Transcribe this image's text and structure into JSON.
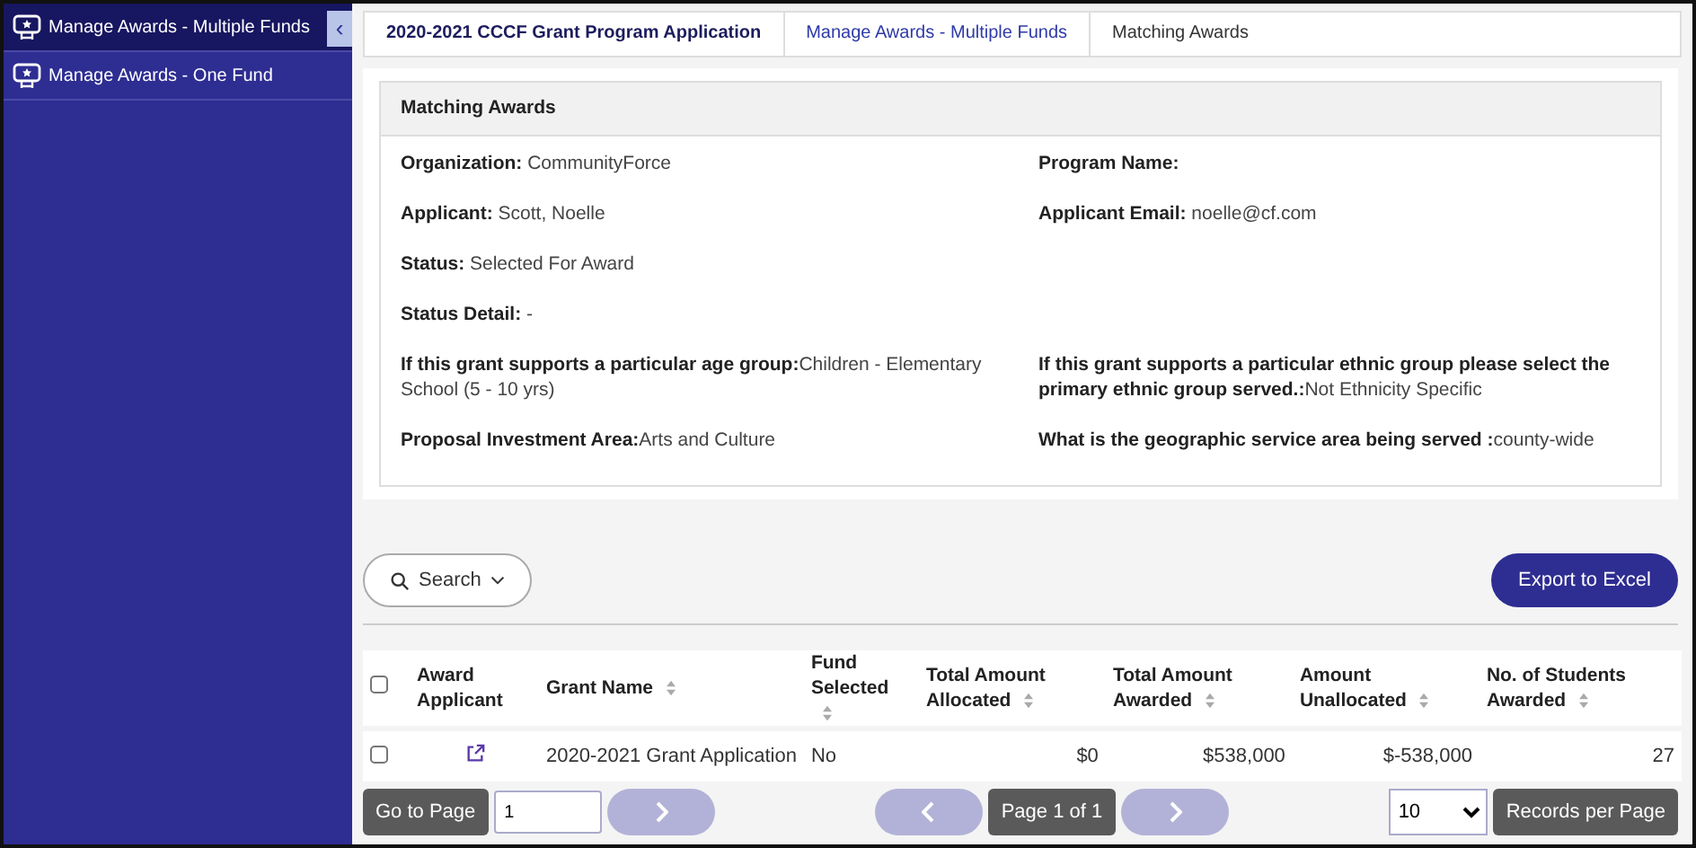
{
  "sidebar": {
    "items": [
      {
        "label": "Manage Awards - Multiple Funds",
        "selected": true
      },
      {
        "label": "Manage Awards - One Fund",
        "selected": false
      }
    ],
    "collapse_icon": "‹"
  },
  "breadcrumb": [
    {
      "label": "2020-2021 CCCF Grant Program Application",
      "kind": "root"
    },
    {
      "label": "Manage Awards - Multiple Funds",
      "kind": "link"
    },
    {
      "label": "Matching Awards",
      "kind": "current"
    }
  ],
  "panel": {
    "title": "Matching Awards",
    "rows": [
      {
        "left": {
          "label": "Organization:",
          "value": " CommunityForce"
        },
        "right": {
          "label": "Program Name:"
        }
      },
      {
        "left": {
          "label": "Applicant:",
          "value": " Scott, Noelle"
        },
        "right": {
          "label": "Applicant Email:",
          "value": " noelle@cf.com"
        }
      },
      {
        "left": {
          "label": "Status:",
          "value": " Selected For Award"
        }
      },
      {
        "left": {
          "label": "Status Detail:",
          "value": " -"
        }
      },
      {
        "left": {
          "label": "If this grant supports a particular age group:",
          "value": "Children - Elementary School (5 - 10 yrs)"
        },
        "right": {
          "label": "If this grant supports a particular ethnic group please select the primary ethnic group served.:",
          "value": "Not Ethnicity Specific"
        }
      },
      {
        "left": {
          "label": "Proposal Investment Area:",
          "value": "Arts and Culture"
        },
        "right": {
          "label": "What is the geographic service area being served :",
          "value": "county-wide"
        }
      }
    ]
  },
  "search_button": "Search",
  "export_button": "Export to Excel",
  "table": {
    "select_all": false,
    "columns": [
      {
        "label": "Award Applicant",
        "sortable": false
      },
      {
        "label": "Grant Name",
        "sortable": true
      },
      {
        "label": "Fund Selected",
        "sortable": true
      },
      {
        "label": "Total Amount Allocated",
        "sortable": true
      },
      {
        "label": "Total Amount Awarded",
        "sortable": true
      },
      {
        "label": "Amount Unallocated",
        "sortable": true
      },
      {
        "label": "No. of Students Awarded",
        "sortable": true
      }
    ],
    "rows": [
      {
        "checked": false,
        "grant_name": "2020-2021 Grant Application",
        "fund_selected": "No",
        "allocated": "$0",
        "awarded": "$538,000",
        "unallocated": "$-538,000",
        "students": "27"
      }
    ]
  },
  "pager": {
    "go_to_page": "Go to Page",
    "page_input": "1",
    "page_label": "Page 1 of 1",
    "page_size": "10",
    "records_per_page": "Records per Page"
  }
}
